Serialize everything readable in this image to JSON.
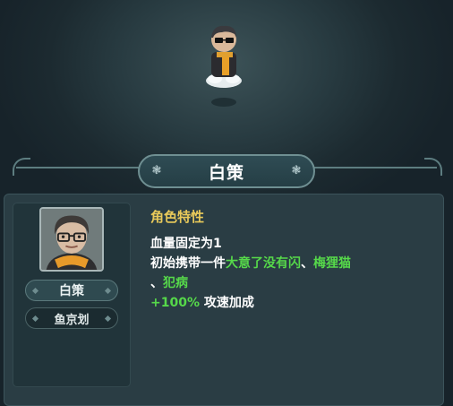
{
  "character": {
    "name": "白策",
    "nickname": "鱼京划"
  },
  "traits": {
    "heading": "角色特性",
    "line1": "血量固定为1",
    "line2_prefix": "初始携带一件",
    "item1": "大意了没有闪",
    "sep1": "、",
    "item2": "梅狸猫",
    "sep2": "、",
    "item3": "犯病",
    "bonus_value": "+100%",
    "bonus_text": " 攻速加成"
  },
  "colors": {
    "accent_gold": "#e8c95a",
    "highlight_green": "#56d94a",
    "panel_bg": "#2a3d44"
  },
  "icons": {
    "title_left": "flower-ornament-icon",
    "title_right": "flower-ornament-icon"
  }
}
